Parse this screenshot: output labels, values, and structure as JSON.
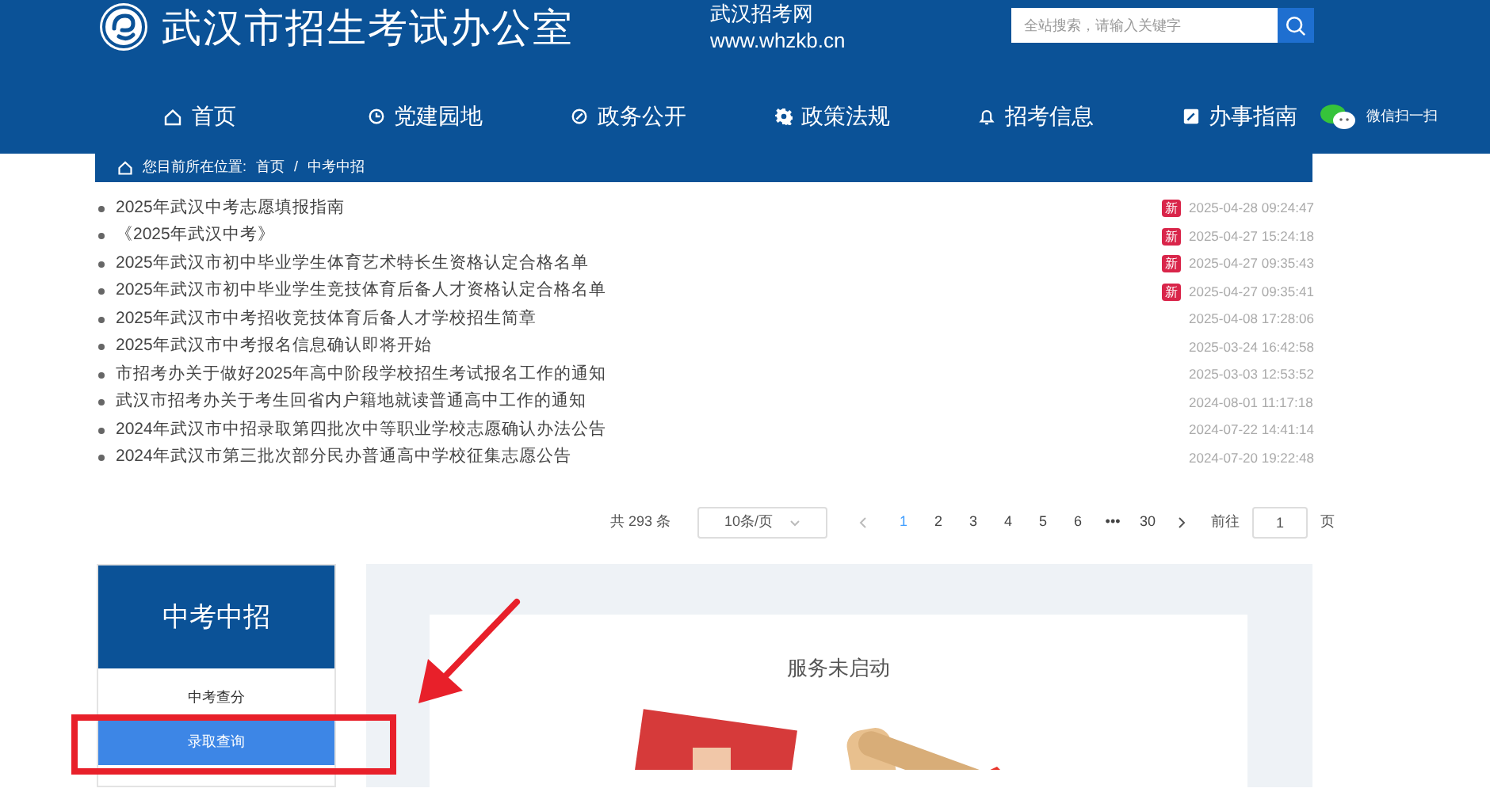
{
  "header": {
    "title": "武汉市招生考试办公室",
    "site_name": "武汉招考网",
    "site_url": "www.whzkb.cn",
    "search": {
      "placeholder": "全站搜索，请输入关键字"
    }
  },
  "nav": [
    {
      "label": "首页",
      "kind": "home"
    },
    {
      "label": "党建园地",
      "kind": "party"
    },
    {
      "label": "政务公开",
      "kind": "affairs"
    },
    {
      "label": "政策法规",
      "kind": "policy"
    },
    {
      "label": "招考信息",
      "kind": "info"
    },
    {
      "label": "办事指南",
      "kind": "guide"
    }
  ],
  "wechat": {
    "label": "微信扫一扫"
  },
  "breadcrumb": {
    "label": "您目前所在位置:",
    "items": [
      "首页",
      "中考中招"
    ],
    "separator": "/"
  },
  "news": [
    {
      "title": "2025年武汉中考志愿填报指南",
      "badge": "新",
      "date": "2025-04-28 09:24:47"
    },
    {
      "title": "《2025年武汉中考》",
      "badge": "新",
      "date": "2025-04-27 15:24:18"
    },
    {
      "title": "2025年武汉市初中毕业学生体育艺术特长生资格认定合格名单",
      "badge": "新",
      "date": "2025-04-27 09:35:43"
    },
    {
      "title": "2025年武汉市初中毕业学生竞技体育后备人才资格认定合格名单",
      "badge": "新",
      "date": "2025-04-27 09:35:41"
    },
    {
      "title": "2025年武汉市中考招收竞技体育后备人才学校招生简章",
      "date": "2025-04-08 17:28:06"
    },
    {
      "title": "2025年武汉市中考报名信息确认即将开始",
      "date": "2025-03-24 16:42:58"
    },
    {
      "title": "市招考办关于做好2025年高中阶段学校招生考试报名工作的通知",
      "date": "2025-03-03 12:53:52"
    },
    {
      "title": "武汉市招考办关于考生回省内户籍地就读普通高中工作的通知",
      "date": "2024-08-01 11:17:18"
    },
    {
      "title": "2024年武汉市中招录取第四批次中等职业学校志愿确认办法公告",
      "date": "2024-07-22 14:41:14"
    },
    {
      "title": "2024年武汉市第三批次部分民办普通高中学校征集志愿公告",
      "date": "2024-07-20 19:22:48"
    }
  ],
  "pagination": {
    "total": "共 293 条",
    "page_size": "10条/页",
    "pages": [
      {
        "label": "1",
        "selected": true
      },
      {
        "label": "2",
        "selected": false
      },
      {
        "label": "3",
        "selected": false
      },
      {
        "label": "4",
        "selected": false
      },
      {
        "label": "5",
        "selected": false
      },
      {
        "label": "6",
        "selected": false
      },
      {
        "label": "•••",
        "selected": false
      },
      {
        "label": "30",
        "selected": false
      }
    ],
    "goto_label": "前往",
    "goto_value": "1",
    "goto_unit": "页"
  },
  "sidebar": {
    "title": "中考中招",
    "items": [
      {
        "label": "中考查分",
        "selected": false
      },
      {
        "label": "录取查询",
        "selected": true
      }
    ]
  },
  "panel": {
    "message": "服务未启动"
  }
}
